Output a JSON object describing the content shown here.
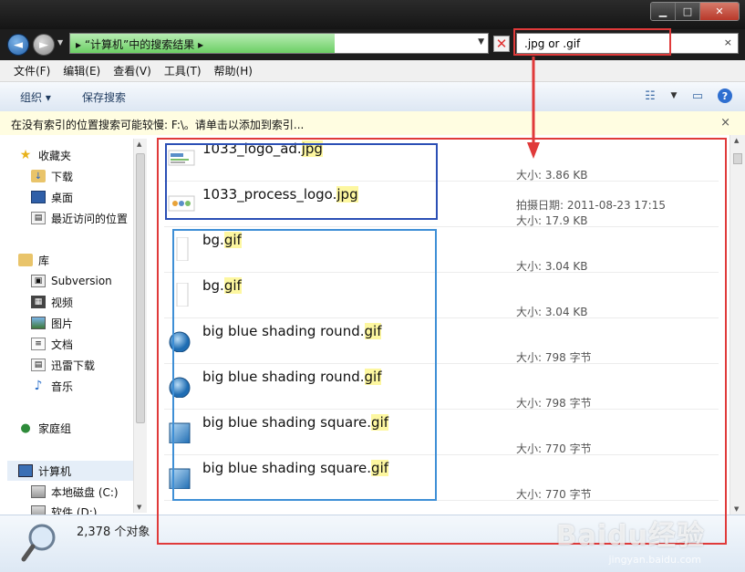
{
  "window": {
    "caption_buttons": {
      "minimize": "▁",
      "maximize": "□",
      "close": "✕"
    }
  },
  "address": {
    "back_icon": "◄",
    "forward_icon": "►",
    "path_text": "▸  “计算机”中的搜索结果  ▸",
    "dropdown": "▼",
    "stop_icon": "✕"
  },
  "search": {
    "value": ".jpg or .gif",
    "clear": "×"
  },
  "menu": {
    "items": [
      "文件(F)",
      "编辑(E)",
      "查看(V)",
      "工具(T)",
      "帮助(H)"
    ]
  },
  "command_bar": {
    "organize": "组织 ▾",
    "save_search": "保存搜索"
  },
  "infobar": {
    "text": "在没有索引的位置搜索可能较慢: F:\\。请单击以添加到索引...",
    "close": "×"
  },
  "nav": {
    "favorites": "收藏夹",
    "downloads": "下载",
    "desktop": "桌面",
    "recent": "最近访问的位置",
    "libraries": "库",
    "subversion": "Subversion",
    "videos": "视频",
    "pictures": "图片",
    "documents": "文档",
    "thunder": "迅雷下载",
    "music": "音乐",
    "homegroup": "家庭组",
    "computer": "计算机",
    "local_disk": "本地磁盘 (C:)",
    "soft_disk": "软件 (D:)"
  },
  "files": [
    {
      "base": "1033_logo_ad.",
      "ext": "jpg",
      "meta1": "",
      "meta2": "大小: 3.86 KB",
      "thumb": "logo"
    },
    {
      "base": "1033_process_logo.",
      "ext": "jpg",
      "meta1": "拍摄日期: 2011-08-23 17:15",
      "meta2": "大小: 17.9 KB",
      "thumb": "logo2"
    },
    {
      "base": "bg.",
      "ext": "gif",
      "meta1": "",
      "meta2": "大小: 3.04 KB",
      "thumb": "blank"
    },
    {
      "base": "bg.",
      "ext": "gif",
      "meta1": "",
      "meta2": "大小: 3.04 KB",
      "thumb": "blank"
    },
    {
      "base": "big blue shading round.",
      "ext": "gif",
      "meta1": "",
      "meta2": "大小: 798 字节",
      "thumb": "round"
    },
    {
      "base": "big blue shading round.",
      "ext": "gif",
      "meta1": "",
      "meta2": "大小: 798 字节",
      "thumb": "round"
    },
    {
      "base": "big blue shading square.",
      "ext": "gif",
      "meta1": "",
      "meta2": "大小: 770 字节",
      "thumb": "square"
    },
    {
      "base": "big blue shading square.",
      "ext": "gif",
      "meta1": "",
      "meta2": "大小: 770 字节",
      "thumb": "square"
    }
  ],
  "status": {
    "count": "2,378 个对象"
  },
  "watermark": {
    "text": "Baidu经验",
    "sub": "jingyan.baidu.com"
  }
}
